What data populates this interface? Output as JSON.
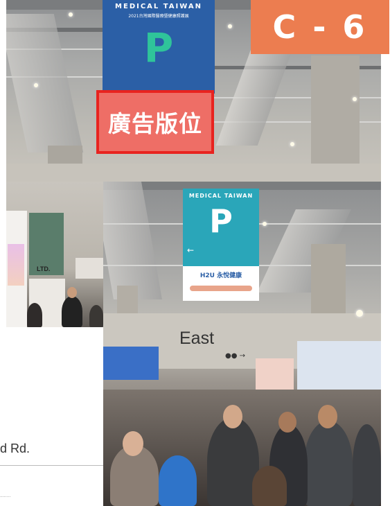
{
  "badge": {
    "label": "C - 6"
  },
  "ad_slot": {
    "label": "廣告版位"
  },
  "top_banner": {
    "brand": "MEDICAL TAIWAN",
    "subtitle": "2021台灣國際醫療暨健康照護展",
    "letter": "P"
  },
  "main_banner": {
    "brand": "MEDICAL TAIWAN",
    "letter": "P",
    "sponsor": "H2U 永悅健康"
  },
  "hall_sign": {
    "label": "East"
  },
  "booth_sign": {
    "label": "LTD."
  },
  "map_fragment": {
    "road_suffix": "d Rd."
  },
  "colors": {
    "badge": "#ec7d50",
    "ad_slot_fill": "#ee6e66",
    "ad_slot_border": "#e8231f",
    "banner_blue": "#2b5fa6",
    "banner_teal": "#2aa6b9",
    "letter_green": "#2fc49a"
  }
}
